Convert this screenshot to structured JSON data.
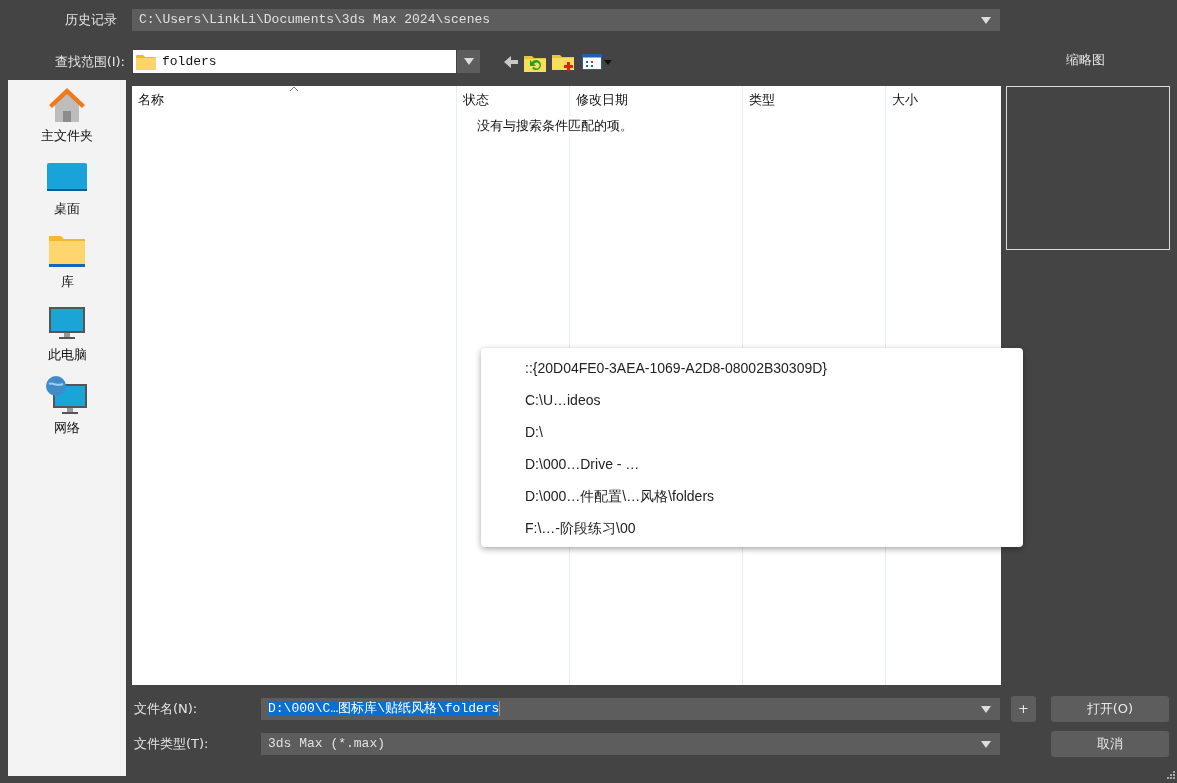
{
  "history": {
    "label": "历史记录",
    "value": "C:\\Users\\LinkLi\\Documents\\3ds Max 2024\\scenes"
  },
  "look_in": {
    "label": "查找范围(I):",
    "value": "folders"
  },
  "thumbnail": {
    "label": "缩略图"
  },
  "sidebar": {
    "items": [
      {
        "label": "主文件夹",
        "kind": "home"
      },
      {
        "label": "桌面",
        "kind": "desktop"
      },
      {
        "label": "库",
        "kind": "library"
      },
      {
        "label": "此电脑",
        "kind": "pc"
      },
      {
        "label": "网络",
        "kind": "network"
      }
    ]
  },
  "table": {
    "columns": [
      {
        "label": "名称",
        "sorted": true
      },
      {
        "label": "状态",
        "sorted": false
      },
      {
        "label": "修改日期",
        "sorted": false
      },
      {
        "label": "类型",
        "sorted": false
      },
      {
        "label": "大小",
        "sorted": false
      }
    ],
    "empty_message": "没有与搜索条件匹配的项。"
  },
  "history_menu": {
    "items": [
      {
        "label": "::{20D04FE0-3AEA-1069-A2D8-08002B30309D}"
      },
      {
        "label": "C:\\U…ideos"
      },
      {
        "label": "D:\\"
      },
      {
        "label": "D:\\000…Drive - …"
      },
      {
        "label": "D:\\000…件配置\\…风格\\folders"
      },
      {
        "label": "F:\\…-阶段练习\\00"
      }
    ]
  },
  "file_name": {
    "label": "文件名(N):",
    "value": "D:\\000\\C…图标库\\贴纸风格\\folders",
    "selected": true
  },
  "file_type": {
    "label": "文件类型(T):",
    "value": "3ds Max (*.max)"
  },
  "buttons": [
    {
      "label": "+",
      "kind": "small"
    },
    {
      "label": "打开(O)",
      "kind": "wide"
    },
    {
      "label": "取消",
      "kind": "wide"
    }
  ]
}
